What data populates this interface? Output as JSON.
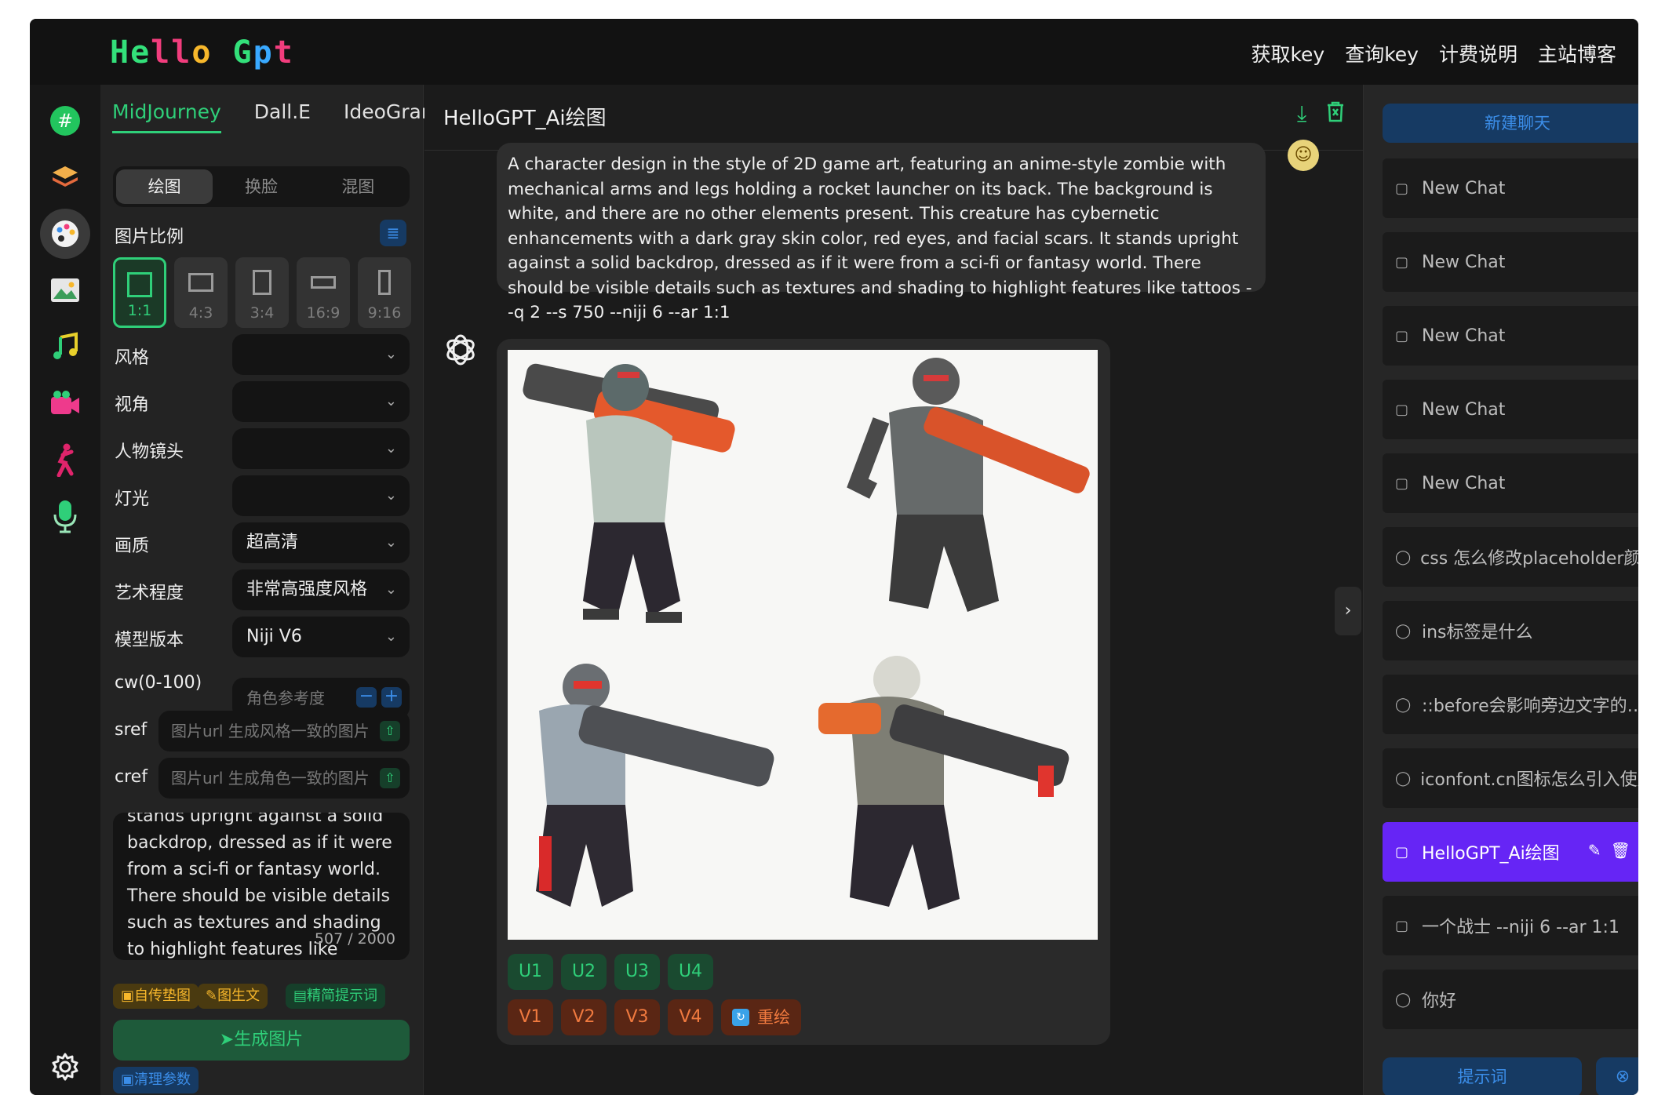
{
  "brand": {
    "logo": "Hello Gpt"
  },
  "topnav": [
    "获取key",
    "查询key",
    "计费说明",
    "主站博客"
  ],
  "rail": [
    {
      "icon": "hash-icon"
    },
    {
      "icon": "layers-icon"
    },
    {
      "icon": "palette-icon"
    },
    {
      "icon": "image-icon"
    },
    {
      "icon": "music-icon"
    },
    {
      "icon": "video-icon"
    },
    {
      "icon": "dancer-icon"
    },
    {
      "icon": "microphone-icon"
    },
    {
      "icon": "gear-icon"
    }
  ],
  "left": {
    "tabs": [
      "MidJourney",
      "Dall.E",
      "IdeoGram"
    ],
    "modes": [
      "绘图",
      "换脸",
      "混图"
    ],
    "ratio_label": "图片比例",
    "ratios": [
      "1:1",
      "4:3",
      "3:4",
      "16:9",
      "9:16"
    ],
    "fields": [
      {
        "label": "风格",
        "value": ""
      },
      {
        "label": "视角",
        "value": ""
      },
      {
        "label": "人物镜头",
        "value": ""
      },
      {
        "label": "灯光",
        "value": ""
      },
      {
        "label": "画质",
        "value": "超高清"
      },
      {
        "label": "艺术程度",
        "value": "非常高强度风格"
      },
      {
        "label": "模型版本",
        "value": "Niji V6"
      }
    ],
    "cw": {
      "label": "cw(0-100)",
      "placeholder": "角色参考度",
      "minus": "−",
      "plus": "+"
    },
    "sref": {
      "label": "sref",
      "placeholder": "图片url 生成风格一致的图片"
    },
    "cref": {
      "label": "cref",
      "placeholder": "图片url 生成角色一致的图片"
    },
    "prompt_text": "stands upright against a solid backdrop, dressed as if it were from a sci-fi or fantasy world. There should be visible details such as textures and shading to highlight features like tattoos",
    "prompt_count": "507 / 2000",
    "chips": [
      "自传垫图",
      "图生文",
      "精简提示词"
    ],
    "generate": "生成图片",
    "clear": "清理参数"
  },
  "main": {
    "title": "HelloGPT_Ai绘图",
    "user_message": "A character design in the style of 2D game art, featuring an anime-style zombie with mechanical arms and legs holding a rocket launcher on its back. The background is white, and there are no other elements present. This creature has cybernetic enhancements with a dark gray skin color, red eyes, and facial scars. It stands upright against a solid backdrop, dressed as if it were from a sci-fi or fantasy world. There should be visible details such as textures and shading to highlight features like tattoos  --q 2 --s 750  --niji 6 --ar 1:1",
    "u_buttons": [
      "U1",
      "U2",
      "U3",
      "U4"
    ],
    "v_buttons": [
      "V1",
      "V2",
      "V3",
      "V4"
    ],
    "redraw": "重绘"
  },
  "right": {
    "new_chat": "新建聊天",
    "chats": [
      {
        "title": "New Chat",
        "icon": "chat-box-icon"
      },
      {
        "title": "New Chat",
        "icon": "chat-box-icon"
      },
      {
        "title": "New Chat",
        "icon": "chat-box-icon"
      },
      {
        "title": "New Chat",
        "icon": "chat-box-icon"
      },
      {
        "title": "New Chat",
        "icon": "chat-box-icon"
      },
      {
        "title": "css 怎么修改placeholder颜…",
        "icon": "chat-bubble-icon"
      },
      {
        "title": "ins标签是什么",
        "icon": "chat-bubble-icon"
      },
      {
        "title": "::before会影响旁边文字的…",
        "icon": "chat-bubble-icon"
      },
      {
        "title": "iconfont.cn图标怎么引入使用",
        "icon": "chat-bubble-icon"
      },
      {
        "title": "HelloGPT_Ai绘图",
        "icon": "chat-box-icon",
        "active": true
      },
      {
        "title": "一个战士 --niji 6 --ar 1:1",
        "icon": "chat-box-icon"
      },
      {
        "title": "你好",
        "icon": "chat-bubble-icon"
      }
    ],
    "hint": "提示词"
  },
  "colors": {
    "accent_green": "#2fcf79",
    "accent_blue": "#3b8de8",
    "active_purple": "#6625f5",
    "orange": "#f07a3f"
  }
}
